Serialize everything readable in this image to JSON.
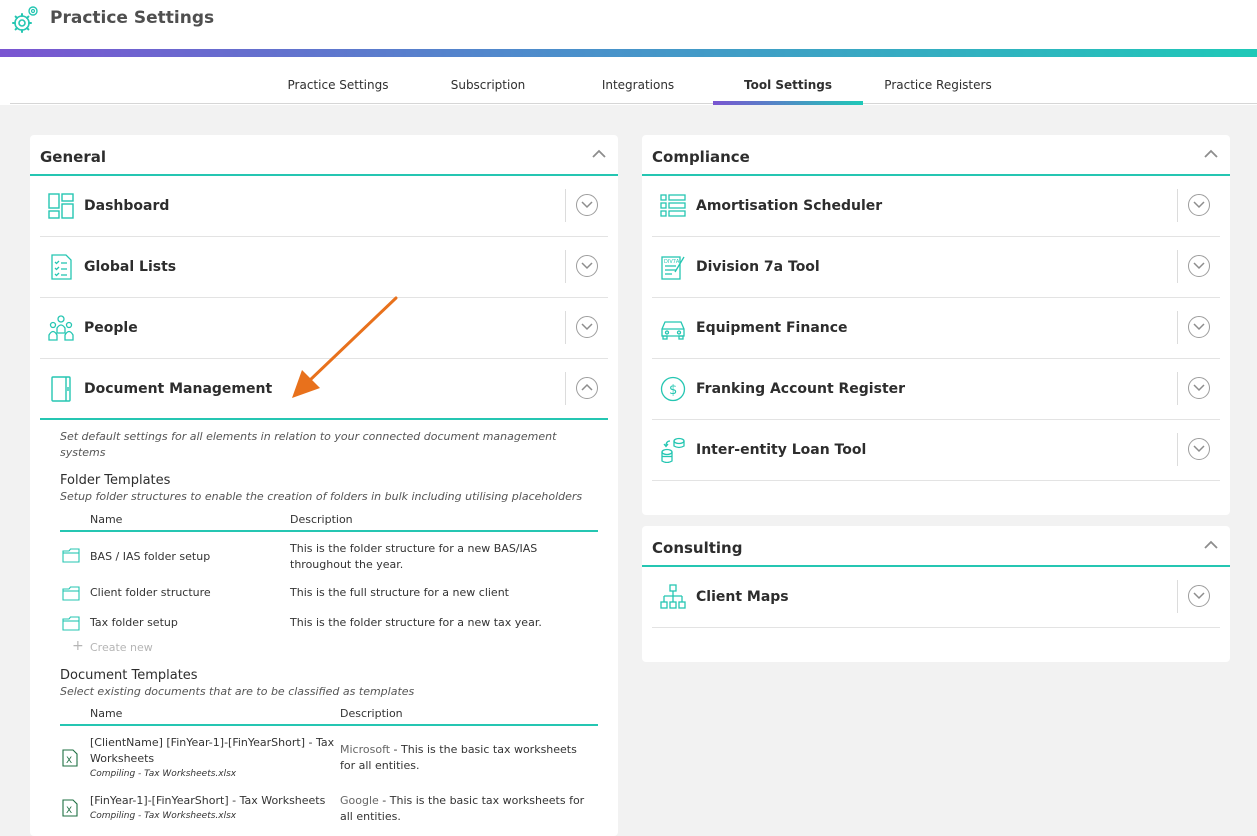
{
  "app": {
    "title": "Practice Settings",
    "logo_icon": "settings-gear-icon"
  },
  "tabs": [
    {
      "label": "Practice Settings",
      "active": false
    },
    {
      "label": "Subscription",
      "active": false
    },
    {
      "label": "Integrations",
      "active": false
    },
    {
      "label": "Tool Settings",
      "active": true
    },
    {
      "label": "Practice Registers",
      "active": false
    }
  ],
  "colors": {
    "accent": "#25c6b2",
    "gradient_start": "#7a55d1",
    "gradient_end": "#1fc9b8",
    "arrow": "#e8711c",
    "icon": "#25c6b2"
  },
  "general": {
    "title": "General",
    "items": [
      {
        "label": "Dashboard",
        "icon": "dashboard-icon"
      },
      {
        "label": "Global Lists",
        "icon": "checklist-icon"
      },
      {
        "label": "People",
        "icon": "people-icon"
      },
      {
        "label": "Document Management",
        "icon": "document-icon"
      }
    ],
    "document_management": {
      "description": "Set default settings for all elements in relation to your connected document management systems",
      "folder_templates": {
        "title": "Folder Templates",
        "subtitle": "Setup folder structures to enable the creation of folders in bulk including utilising placeholders",
        "columns": [
          "Name",
          "Description"
        ],
        "rows": [
          {
            "name": "BAS / IAS folder setup",
            "description": "This is the folder structure for a new BAS/IAS throughout the year."
          },
          {
            "name": "Client folder structure",
            "description": "This is the full structure for a new client"
          },
          {
            "name": "Tax folder setup",
            "description": "This is the folder structure for a new tax year."
          }
        ],
        "create_new": "Create new"
      },
      "document_templates": {
        "title": "Document Templates",
        "subtitle": "Select existing documents that are to be classified as templates",
        "columns": [
          "Name",
          "Description"
        ],
        "rows": [
          {
            "name": "[ClientName] [FinYear-1]-[FinYearShort] - Tax Worksheets",
            "path": "Compiling - Tax Worksheets.xlsx",
            "provider": "Microsoft",
            "description": " - This is the basic tax worksheets for all entities."
          },
          {
            "name": "[FinYear-1]-[FinYearShort] - Tax Worksheets",
            "path": "Compiling - Tax Worksheets.xlsx",
            "provider": "Google",
            "description": " - This is the basic tax worksheets for all entities."
          }
        ]
      }
    }
  },
  "compliance": {
    "title": "Compliance",
    "items": [
      {
        "label": "Amortisation Scheduler",
        "icon": "list-icon"
      },
      {
        "label": "Division 7a Tool",
        "icon": "div7a-form-icon"
      },
      {
        "label": "Equipment Finance",
        "icon": "car-icon"
      },
      {
        "label": "Franking Account Register",
        "icon": "dollar-circle-icon"
      },
      {
        "label": "Inter-entity Loan Tool",
        "icon": "coins-transfer-icon"
      }
    ]
  },
  "consulting": {
    "title": "Consulting",
    "items": [
      {
        "label": "Client Maps",
        "icon": "org-chart-icon"
      }
    ]
  }
}
